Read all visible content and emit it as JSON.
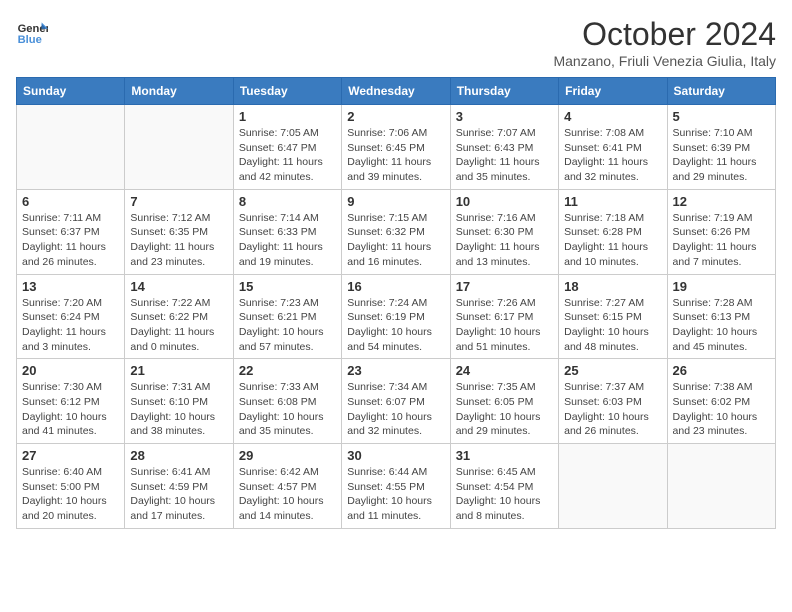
{
  "header": {
    "logo_general": "General",
    "logo_blue": "Blue",
    "month_title": "October 2024",
    "subtitle": "Manzano, Friuli Venezia Giulia, Italy"
  },
  "weekdays": [
    "Sunday",
    "Monday",
    "Tuesday",
    "Wednesday",
    "Thursday",
    "Friday",
    "Saturday"
  ],
  "weeks": [
    [
      {
        "day": "",
        "empty": true
      },
      {
        "day": "",
        "empty": true
      },
      {
        "day": "1",
        "sunrise": "7:05 AM",
        "sunset": "6:47 PM",
        "daylight": "11 hours and 42 minutes."
      },
      {
        "day": "2",
        "sunrise": "7:06 AM",
        "sunset": "6:45 PM",
        "daylight": "11 hours and 39 minutes."
      },
      {
        "day": "3",
        "sunrise": "7:07 AM",
        "sunset": "6:43 PM",
        "daylight": "11 hours and 35 minutes."
      },
      {
        "day": "4",
        "sunrise": "7:08 AM",
        "sunset": "6:41 PM",
        "daylight": "11 hours and 32 minutes."
      },
      {
        "day": "5",
        "sunrise": "7:10 AM",
        "sunset": "6:39 PM",
        "daylight": "11 hours and 29 minutes."
      }
    ],
    [
      {
        "day": "6",
        "sunrise": "7:11 AM",
        "sunset": "6:37 PM",
        "daylight": "11 hours and 26 minutes."
      },
      {
        "day": "7",
        "sunrise": "7:12 AM",
        "sunset": "6:35 PM",
        "daylight": "11 hours and 23 minutes."
      },
      {
        "day": "8",
        "sunrise": "7:14 AM",
        "sunset": "6:33 PM",
        "daylight": "11 hours and 19 minutes."
      },
      {
        "day": "9",
        "sunrise": "7:15 AM",
        "sunset": "6:32 PM",
        "daylight": "11 hours and 16 minutes."
      },
      {
        "day": "10",
        "sunrise": "7:16 AM",
        "sunset": "6:30 PM",
        "daylight": "11 hours and 13 minutes."
      },
      {
        "day": "11",
        "sunrise": "7:18 AM",
        "sunset": "6:28 PM",
        "daylight": "11 hours and 10 minutes."
      },
      {
        "day": "12",
        "sunrise": "7:19 AM",
        "sunset": "6:26 PM",
        "daylight": "11 hours and 7 minutes."
      }
    ],
    [
      {
        "day": "13",
        "sunrise": "7:20 AM",
        "sunset": "6:24 PM",
        "daylight": "11 hours and 3 minutes."
      },
      {
        "day": "14",
        "sunrise": "7:22 AM",
        "sunset": "6:22 PM",
        "daylight": "11 hours and 0 minutes."
      },
      {
        "day": "15",
        "sunrise": "7:23 AM",
        "sunset": "6:21 PM",
        "daylight": "10 hours and 57 minutes."
      },
      {
        "day": "16",
        "sunrise": "7:24 AM",
        "sunset": "6:19 PM",
        "daylight": "10 hours and 54 minutes."
      },
      {
        "day": "17",
        "sunrise": "7:26 AM",
        "sunset": "6:17 PM",
        "daylight": "10 hours and 51 minutes."
      },
      {
        "day": "18",
        "sunrise": "7:27 AM",
        "sunset": "6:15 PM",
        "daylight": "10 hours and 48 minutes."
      },
      {
        "day": "19",
        "sunrise": "7:28 AM",
        "sunset": "6:13 PM",
        "daylight": "10 hours and 45 minutes."
      }
    ],
    [
      {
        "day": "20",
        "sunrise": "7:30 AM",
        "sunset": "6:12 PM",
        "daylight": "10 hours and 41 minutes."
      },
      {
        "day": "21",
        "sunrise": "7:31 AM",
        "sunset": "6:10 PM",
        "daylight": "10 hours and 38 minutes."
      },
      {
        "day": "22",
        "sunrise": "7:33 AM",
        "sunset": "6:08 PM",
        "daylight": "10 hours and 35 minutes."
      },
      {
        "day": "23",
        "sunrise": "7:34 AM",
        "sunset": "6:07 PM",
        "daylight": "10 hours and 32 minutes."
      },
      {
        "day": "24",
        "sunrise": "7:35 AM",
        "sunset": "6:05 PM",
        "daylight": "10 hours and 29 minutes."
      },
      {
        "day": "25",
        "sunrise": "7:37 AM",
        "sunset": "6:03 PM",
        "daylight": "10 hours and 26 minutes."
      },
      {
        "day": "26",
        "sunrise": "7:38 AM",
        "sunset": "6:02 PM",
        "daylight": "10 hours and 23 minutes."
      }
    ],
    [
      {
        "day": "27",
        "sunrise": "6:40 AM",
        "sunset": "5:00 PM",
        "daylight": "10 hours and 20 minutes."
      },
      {
        "day": "28",
        "sunrise": "6:41 AM",
        "sunset": "4:59 PM",
        "daylight": "10 hours and 17 minutes."
      },
      {
        "day": "29",
        "sunrise": "6:42 AM",
        "sunset": "4:57 PM",
        "daylight": "10 hours and 14 minutes."
      },
      {
        "day": "30",
        "sunrise": "6:44 AM",
        "sunset": "4:55 PM",
        "daylight": "10 hours and 11 minutes."
      },
      {
        "day": "31",
        "sunrise": "6:45 AM",
        "sunset": "4:54 PM",
        "daylight": "10 hours and 8 minutes."
      },
      {
        "day": "",
        "empty": true
      },
      {
        "day": "",
        "empty": true
      }
    ]
  ],
  "labels": {
    "sunrise": "Sunrise:",
    "sunset": "Sunset:",
    "daylight": "Daylight:"
  }
}
